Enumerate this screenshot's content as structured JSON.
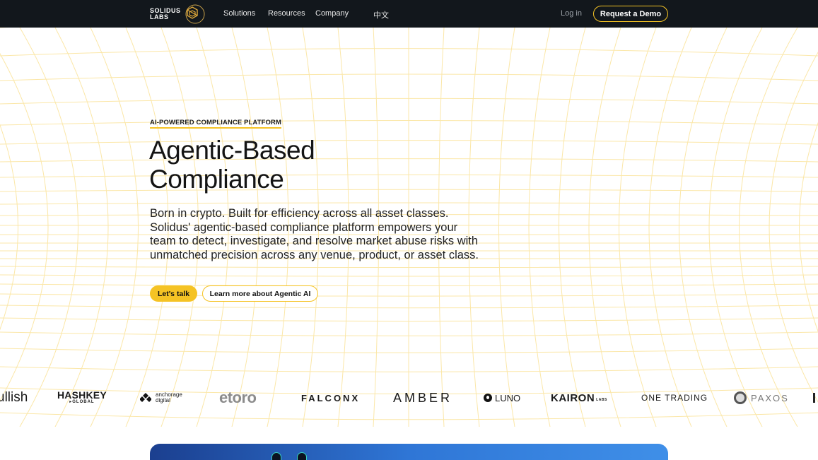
{
  "header": {
    "logo_line1": "SOLIDUS",
    "logo_line2": "LABS",
    "nav": [
      "Solutions",
      "Resources",
      "Company",
      "中文"
    ],
    "login": "Log in",
    "demo_button": "Request a Demo"
  },
  "hero": {
    "eyebrow": "AI-POWERED COMPLIANCE PLATFORM",
    "title_line1": "Agentic-Based",
    "title_line2": "Compliance",
    "description": "Born in crypto. Built for efficiency across all asset classes. Solidus' agentic-based compliance platform empowers your team to detect, investigate, and resolve market abuse risks with unmatched precision across any venue, product, or asset class.",
    "primary_button": "Let's talk",
    "secondary_button": "Learn more about Agentic AI"
  },
  "logos": {
    "bullish": "ullish",
    "hashkey": "HASHKEY",
    "hashkey_sub": "▸GLOBAL",
    "anchorage_1": "anchorage",
    "anchorage_2": "digital",
    "etoro": "etoro",
    "falconx": "FALCONX",
    "amber": "AMBER",
    "luno": "LUNO",
    "kairon": "KAIRON",
    "kairon_sub": "LABS",
    "onetrading": "ONE TRADING",
    "paxos": "PAXOS"
  },
  "colors": {
    "accent": "#f5c324",
    "nav_bg": "#12171c",
    "grid_line": "#fbe7a8"
  }
}
